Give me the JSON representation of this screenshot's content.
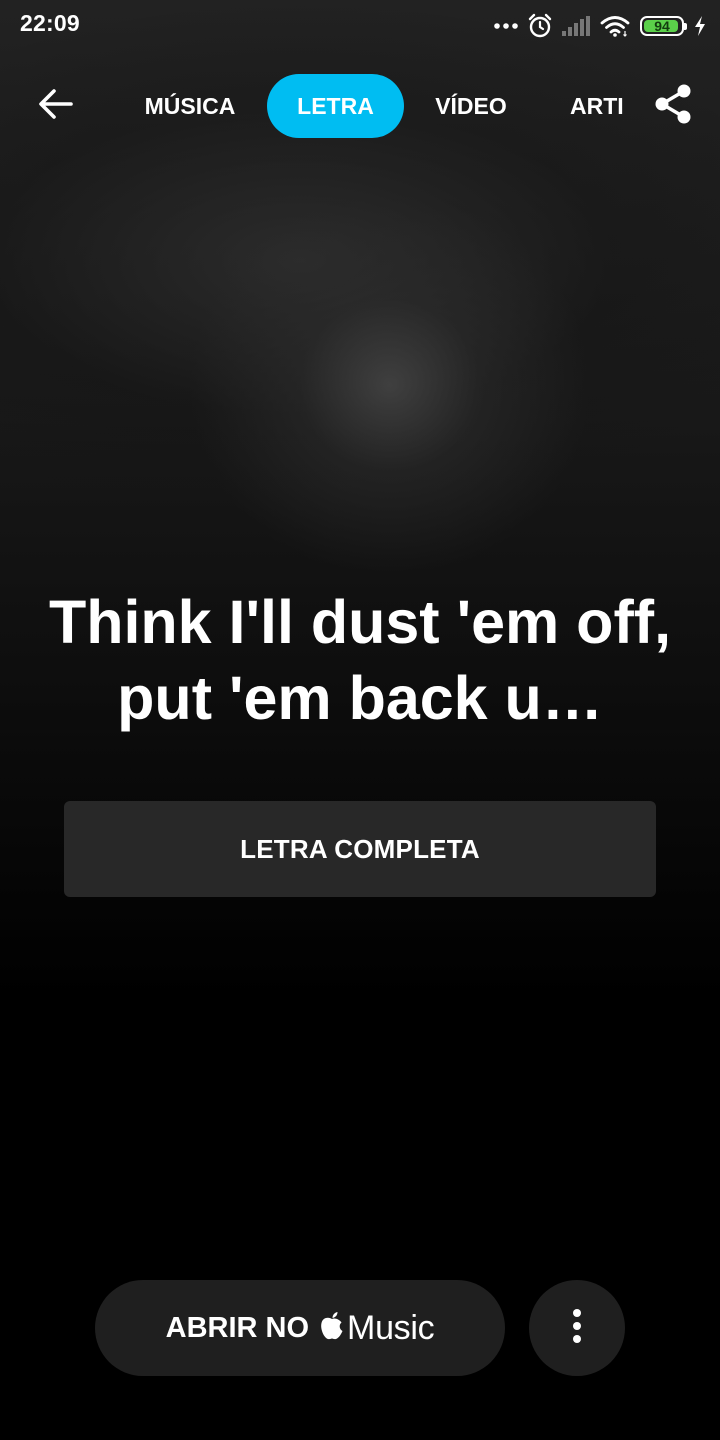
{
  "status_bar": {
    "time": "22:09",
    "battery_level": "94",
    "battery_fraction": 0.94,
    "icons": [
      "more-dots-icon",
      "alarm-icon",
      "signal-icon",
      "wifi-icon",
      "battery-icon",
      "charging-bolt-icon"
    ]
  },
  "nav": {
    "back_icon": "arrow-left-icon",
    "share_icon": "share-icon",
    "tabs": [
      {
        "label": "MÚSICA",
        "active": false
      },
      {
        "label": "LETRA",
        "active": true
      },
      {
        "label": "VÍDEO",
        "active": false
      },
      {
        "label": "ARTISTA",
        "active": false
      }
    ]
  },
  "lyric": {
    "excerpt": "Think I'll dust 'em off, put 'em back u…"
  },
  "full_lyrics_button": {
    "label": "LETRA COMPLETA"
  },
  "bottom": {
    "open_label": "ABRIR NO",
    "brand_icon": "apple-logo-icon",
    "brand_text": "Music",
    "more_icon": "more-vertical-icon"
  },
  "colors": {
    "accent": "#00bdf2",
    "battery_green": "#5bd14a",
    "button_bg": "#282828",
    "pill_bg": "#1f1f1f"
  }
}
